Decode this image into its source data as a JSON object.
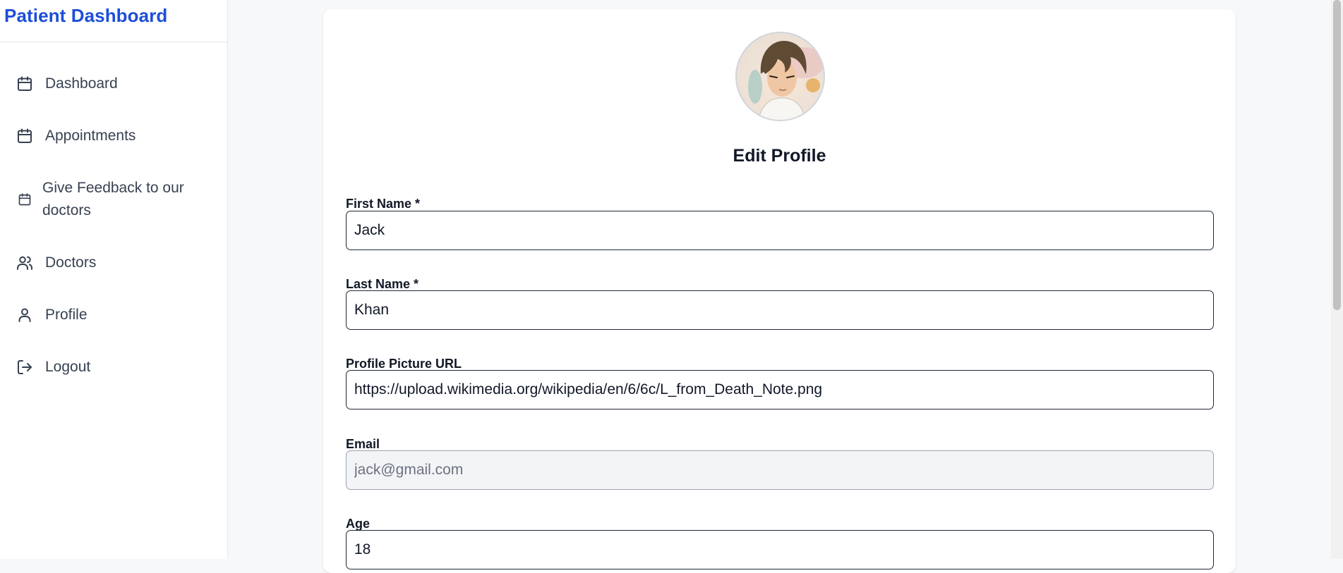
{
  "sidebar": {
    "brand": "Patient Dashboard",
    "items": [
      {
        "label": "Dashboard",
        "icon": "calendar-icon"
      },
      {
        "label": "Appointments",
        "icon": "calendar-icon"
      },
      {
        "label": "Give Feedback to our doctors",
        "icon": "calendar-icon"
      },
      {
        "label": "Doctors",
        "icon": "users-icon"
      },
      {
        "label": "Profile",
        "icon": "user-icon"
      },
      {
        "label": "Logout",
        "icon": "logout-icon"
      }
    ]
  },
  "profile_form": {
    "title": "Edit Profile",
    "first_name": {
      "label": "First Name *",
      "value": "Jack"
    },
    "last_name": {
      "label": "Last Name *",
      "value": "Khan"
    },
    "picture_url": {
      "label": "Profile Picture URL",
      "value": "https://upload.wikimedia.org/wikipedia/en/6/6c/L_from_Death_Note.png"
    },
    "email": {
      "label": "Email",
      "value": "jack@gmail.com"
    },
    "age": {
      "label": "Age",
      "value": "18"
    }
  },
  "colors": {
    "brand": "#1d4ed8",
    "background": "#f7f8fa",
    "card": "#ffffff",
    "disabled_field": "#f3f4f6"
  }
}
